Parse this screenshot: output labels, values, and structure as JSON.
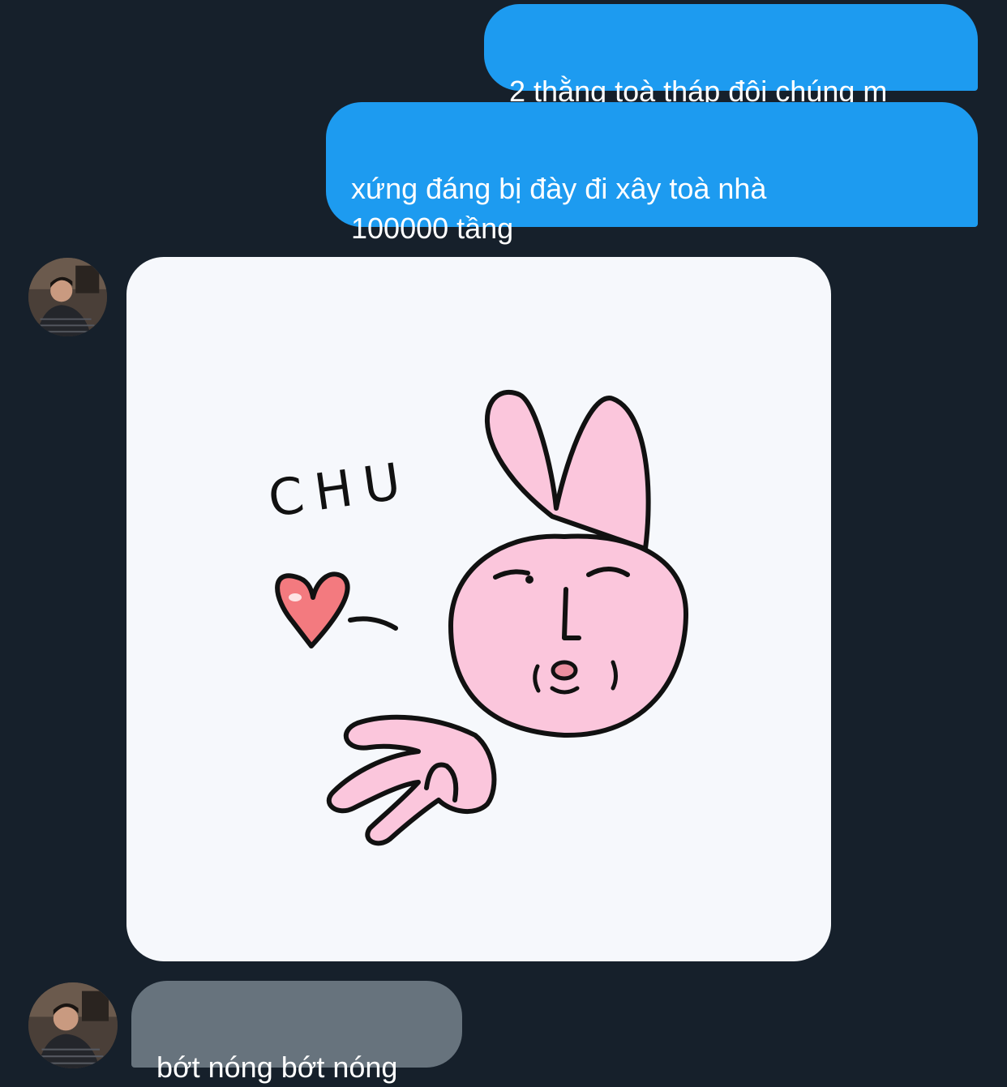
{
  "messages": {
    "outgoing_1": "2 thằng toà tháp đôi chúng m",
    "outgoing_2": "xứng đáng bị đày đi xây toà nhà\n100000 tầng",
    "incoming_1": "bớt nóng bớt nóng"
  },
  "sticker": {
    "text": "CHU"
  },
  "colors": {
    "background": "#16202b",
    "outgoing_bubble": "#1d9bf0",
    "incoming_bubble": "#67737d",
    "sticker_card": "#f6f8fc",
    "bunny_pink": "#fbc6dc"
  }
}
